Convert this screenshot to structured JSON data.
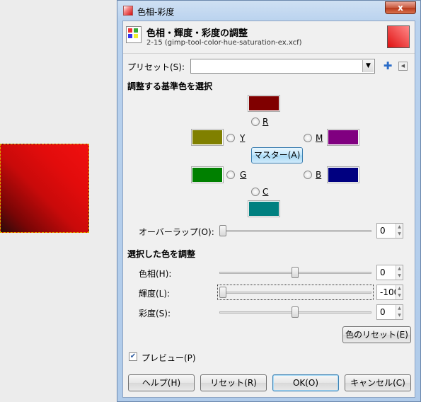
{
  "window": {
    "title": "色相-彩度",
    "close_label": "x"
  },
  "header": {
    "title": "色相・輝度・彩度の調整",
    "subtitle": "2-15 (gimp-tool-color-hue-saturation-ex.xcf)"
  },
  "presets": {
    "label": "プリセット(S):",
    "value": "",
    "add_icon": "plus-icon",
    "menu_icon": "menu-arrow-icon"
  },
  "primary": {
    "heading": "調整する基準色を選択",
    "colors": {
      "R": {
        "label": "R",
        "color": "#800000"
      },
      "Y": {
        "label": "Y",
        "color": "#808000"
      },
      "G": {
        "label": "G",
        "color": "#008000"
      },
      "C": {
        "label": "C",
        "color": "#008080"
      },
      "B": {
        "label": "B",
        "color": "#000080"
      },
      "M": {
        "label": "M",
        "color": "#800080"
      }
    },
    "master_label": "マスター(A)"
  },
  "overlap": {
    "label": "オーバーラップ(O):",
    "value": "0",
    "fraction": 0.0
  },
  "adjust": {
    "heading": "選択した色を調整",
    "hue": {
      "label": "色相(H):",
      "value": "0",
      "fraction": 0.5
    },
    "lightness": {
      "label": "輝度(L):",
      "value": "-100",
      "fraction": 0.0
    },
    "saturation": {
      "label": "彩度(S):",
      "value": "0",
      "fraction": 0.5
    }
  },
  "reset_color_label": "色のリセット(E)",
  "preview": {
    "label": "プレビュー(P)",
    "checked": true
  },
  "buttons": {
    "help": "ヘルプ(H)",
    "reset": "リセット(R)",
    "ok": "OK(O)",
    "cancel": "キャンセル(C)"
  }
}
